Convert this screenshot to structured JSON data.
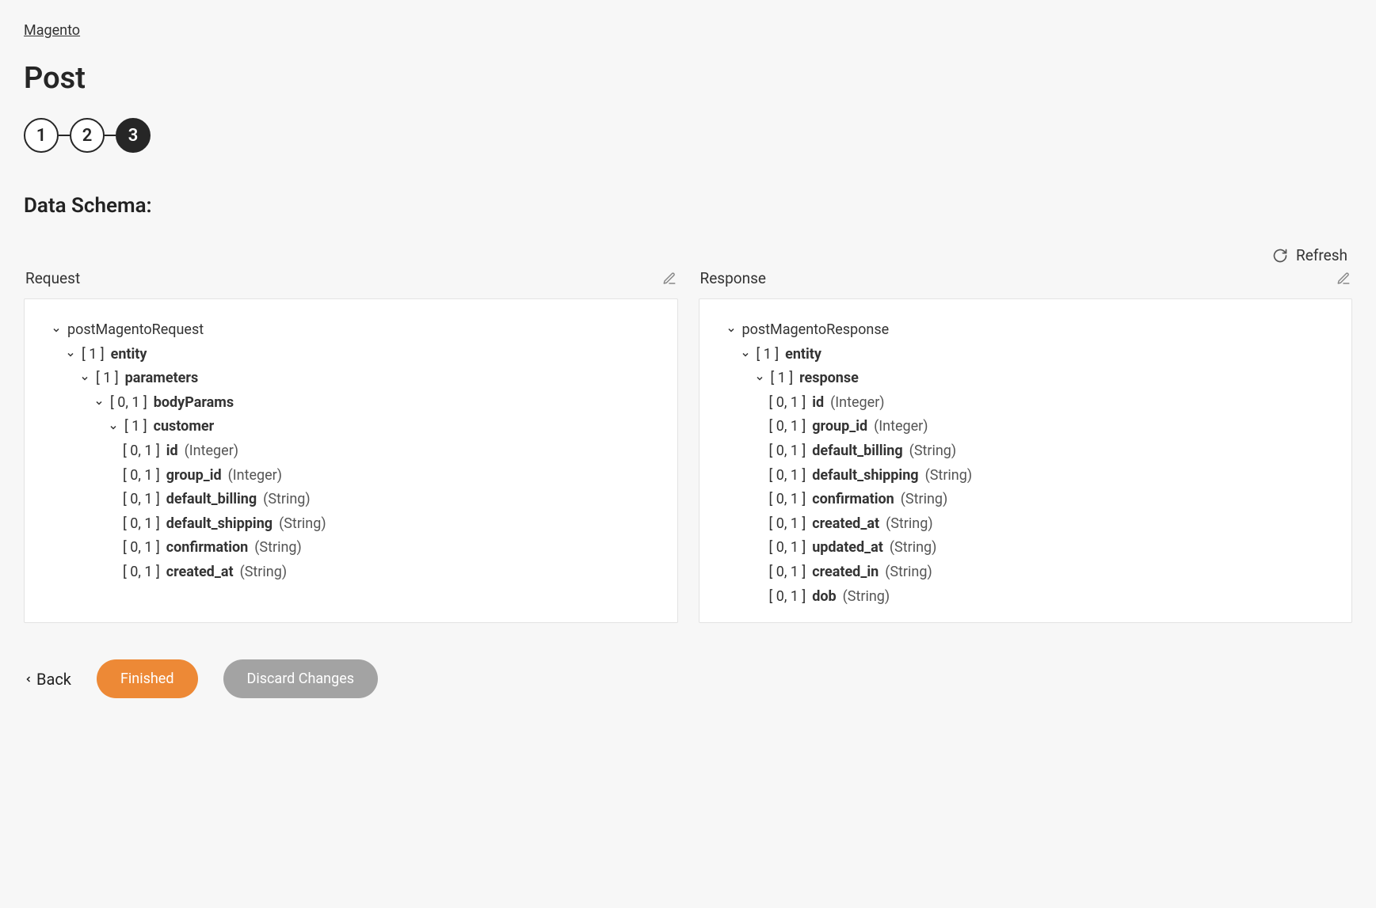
{
  "breadcrumb": "Magento",
  "title": "Post",
  "stepper": {
    "steps": [
      "1",
      "2",
      "3"
    ],
    "activeIndex": 2
  },
  "section_heading": "Data Schema:",
  "refresh_label": "Refresh",
  "request": {
    "header": "Request",
    "root": "postMagentoRequest",
    "entity": {
      "card": "[ 1 ]",
      "name": "entity"
    },
    "parameters": {
      "card": "[ 1 ]",
      "name": "parameters"
    },
    "bodyParams": {
      "card": "[ 0, 1 ]",
      "name": "bodyParams"
    },
    "customer": {
      "card": "[ 1 ]",
      "name": "customer"
    },
    "fields": [
      {
        "card": "[ 0, 1 ]",
        "name": "id",
        "type": "(Integer)"
      },
      {
        "card": "[ 0, 1 ]",
        "name": "group_id",
        "type": "(Integer)"
      },
      {
        "card": "[ 0, 1 ]",
        "name": "default_billing",
        "type": "(String)"
      },
      {
        "card": "[ 0, 1 ]",
        "name": "default_shipping",
        "type": "(String)"
      },
      {
        "card": "[ 0, 1 ]",
        "name": "confirmation",
        "type": "(String)"
      },
      {
        "card": "[ 0, 1 ]",
        "name": "created_at",
        "type": "(String)"
      }
    ]
  },
  "response": {
    "header": "Response",
    "root": "postMagentoResponse",
    "entity": {
      "card": "[ 1 ]",
      "name": "entity"
    },
    "responseNode": {
      "card": "[ 1 ]",
      "name": "response"
    },
    "fields": [
      {
        "card": "[ 0, 1 ]",
        "name": "id",
        "type": "(Integer)"
      },
      {
        "card": "[ 0, 1 ]",
        "name": "group_id",
        "type": "(Integer)"
      },
      {
        "card": "[ 0, 1 ]",
        "name": "default_billing",
        "type": "(String)"
      },
      {
        "card": "[ 0, 1 ]",
        "name": "default_shipping",
        "type": "(String)"
      },
      {
        "card": "[ 0, 1 ]",
        "name": "confirmation",
        "type": "(String)"
      },
      {
        "card": "[ 0, 1 ]",
        "name": "created_at",
        "type": "(String)"
      },
      {
        "card": "[ 0, 1 ]",
        "name": "updated_at",
        "type": "(String)"
      },
      {
        "card": "[ 0, 1 ]",
        "name": "created_in",
        "type": "(String)"
      },
      {
        "card": "[ 0, 1 ]",
        "name": "dob",
        "type": "(String)"
      }
    ]
  },
  "footer": {
    "back": "Back",
    "finished": "Finished",
    "discard": "Discard Changes"
  }
}
